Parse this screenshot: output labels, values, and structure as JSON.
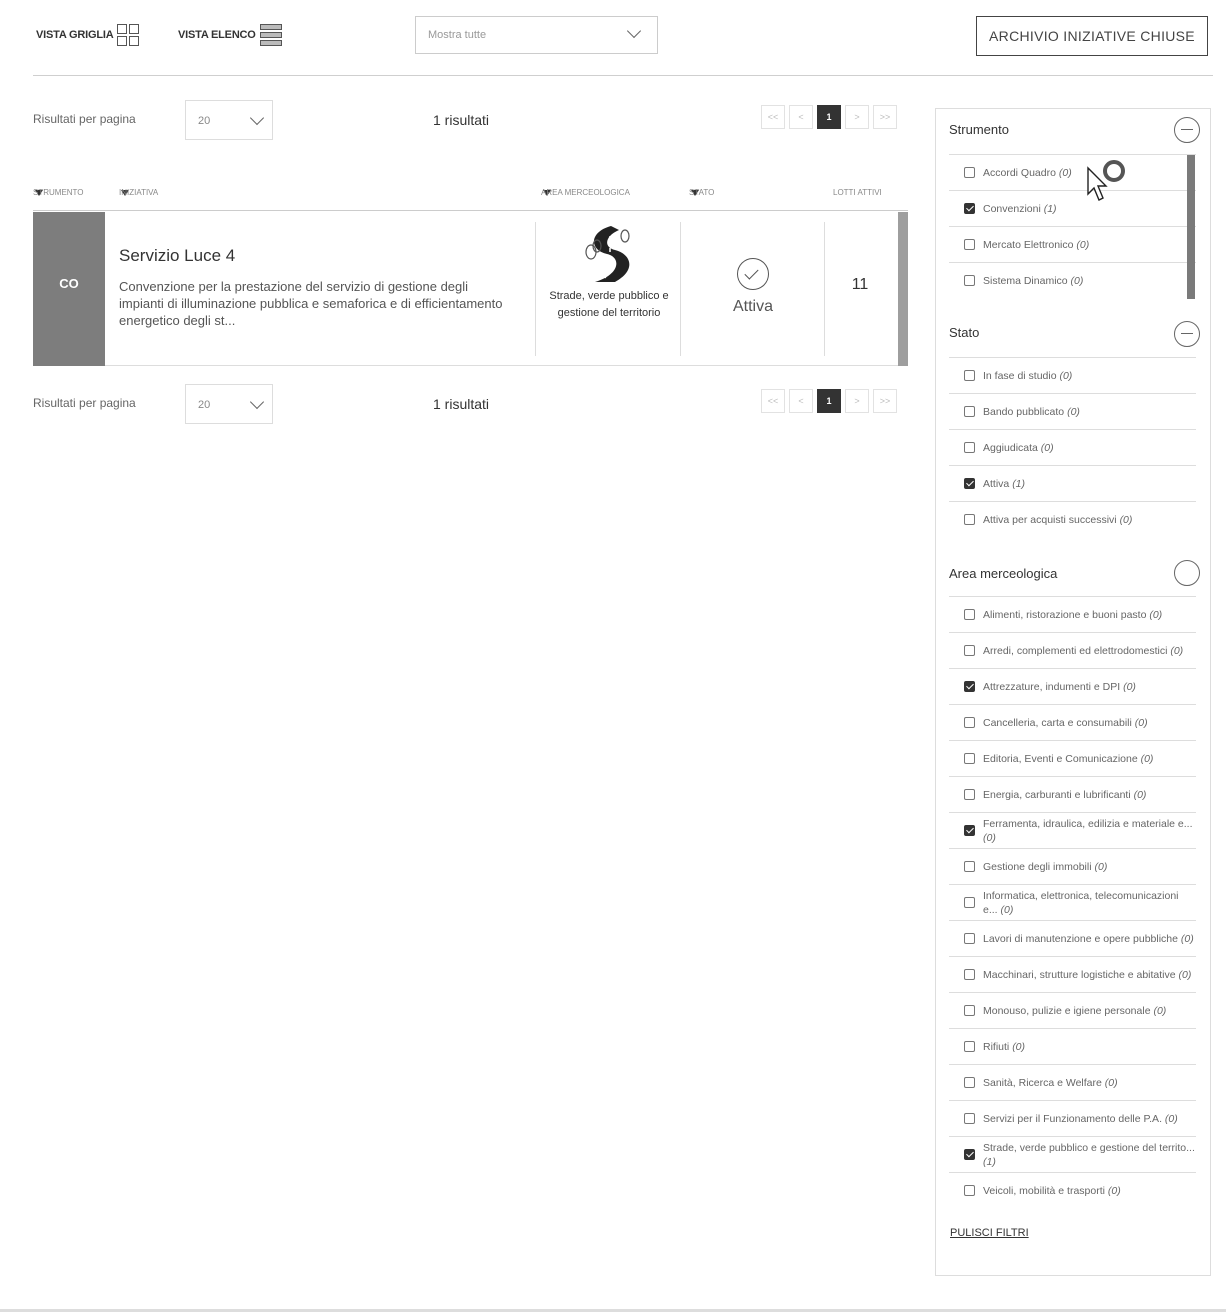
{
  "toolbar": {
    "grid_view": "VISTA GRIGLIA",
    "list_view": "VISTA ELENCO",
    "show_all": "Mostra tutte",
    "archive_button": "ARCHIVIO INIZIATIVE CHIUSE"
  },
  "results": {
    "per_page_label": "Risultati per pagina",
    "per_page_value": "20",
    "count": "1 risultati",
    "pager": [
      "<<",
      "<",
      "1",
      ">",
      ">>"
    ],
    "current_page": "1"
  },
  "table": {
    "columns": [
      "STRUMENTO",
      "INIZIATIVA",
      "AREA MERCEOLOGICA",
      "STATO",
      "LOTTI ATTIVI"
    ],
    "rows": [
      {
        "badge": "CO",
        "title": "Servizio Luce 4",
        "description": "Convenzione per la prestazione del servizio di gestione degli impianti di illuminazione pubblica e semaforica e di efficientamento energetico degli st...",
        "area": "Strade, verde pubblico e gestione del territorio",
        "stato": "Attiva",
        "lotti": "11"
      }
    ]
  },
  "filters": {
    "strumento": {
      "title": "Strumento",
      "items": [
        {
          "label": "Accordi Quadro",
          "count": "(0)",
          "checked": false
        },
        {
          "label": "Convenzioni",
          "count": "(1)",
          "checked": true
        },
        {
          "label": "Mercato Elettronico",
          "count": "(0)",
          "checked": false
        },
        {
          "label": "Sistema Dinamico",
          "count": "(0)",
          "checked": false
        }
      ]
    },
    "stato": {
      "title": "Stato",
      "items": [
        {
          "label": "In fase di studio",
          "count": "(0)",
          "checked": false
        },
        {
          "label": "Bando pubblicato",
          "count": "(0)",
          "checked": false
        },
        {
          "label": "Aggiudicata",
          "count": "(0)",
          "checked": false
        },
        {
          "label": "Attiva",
          "count": "(1)",
          "checked": true
        },
        {
          "label": "Attiva per acquisti successivi",
          "count": "(0)",
          "checked": false
        }
      ]
    },
    "area": {
      "title": "Area merceologica",
      "items": [
        {
          "label": "Alimenti, ristorazione e buoni pasto",
          "count": "(0)",
          "checked": false
        },
        {
          "label": "Arredi, complementi ed elettrodomestici",
          "count": "(0)",
          "checked": false
        },
        {
          "label": "Attrezzature, indumenti e DPI",
          "count": "(0)",
          "checked": true
        },
        {
          "label": "Cancelleria, carta e consumabili",
          "count": "(0)",
          "checked": false
        },
        {
          "label": "Editoria, Eventi e Comunicazione",
          "count": "(0)",
          "checked": false
        },
        {
          "label": "Energia, carburanti e lubrificanti",
          "count": "(0)",
          "checked": false
        },
        {
          "label": "Ferramenta, idraulica, edilizia e materiale e...",
          "count": "(0)",
          "checked": true
        },
        {
          "label": "Gestione degli immobili",
          "count": "(0)",
          "checked": false
        },
        {
          "label": "Informatica, elettronica, telecomunicazioni e...",
          "count": "(0)",
          "checked": false
        },
        {
          "label": "Lavori di manutenzione e opere pubbliche",
          "count": "(0)",
          "checked": false
        },
        {
          "label": "Macchinari, strutture logistiche e abitative",
          "count": "(0)",
          "checked": false
        },
        {
          "label": "Monouso, pulizie e igiene personale",
          "count": "(0)",
          "checked": false
        },
        {
          "label": "Rifiuti",
          "count": "(0)",
          "checked": false
        },
        {
          "label": "Sanità, Ricerca e Welfare",
          "count": "(0)",
          "checked": false
        },
        {
          "label": "Servizi per il Funzionamento delle P.A.",
          "count": "(0)",
          "checked": false
        },
        {
          "label": "Strade, verde pubblico e gestione del territo...",
          "count": "(1)",
          "checked": true
        },
        {
          "label": "Veicoli, mobilità e trasporti",
          "count": "(0)",
          "checked": false
        }
      ]
    },
    "clear_label": "PULISCI FILTRI"
  }
}
